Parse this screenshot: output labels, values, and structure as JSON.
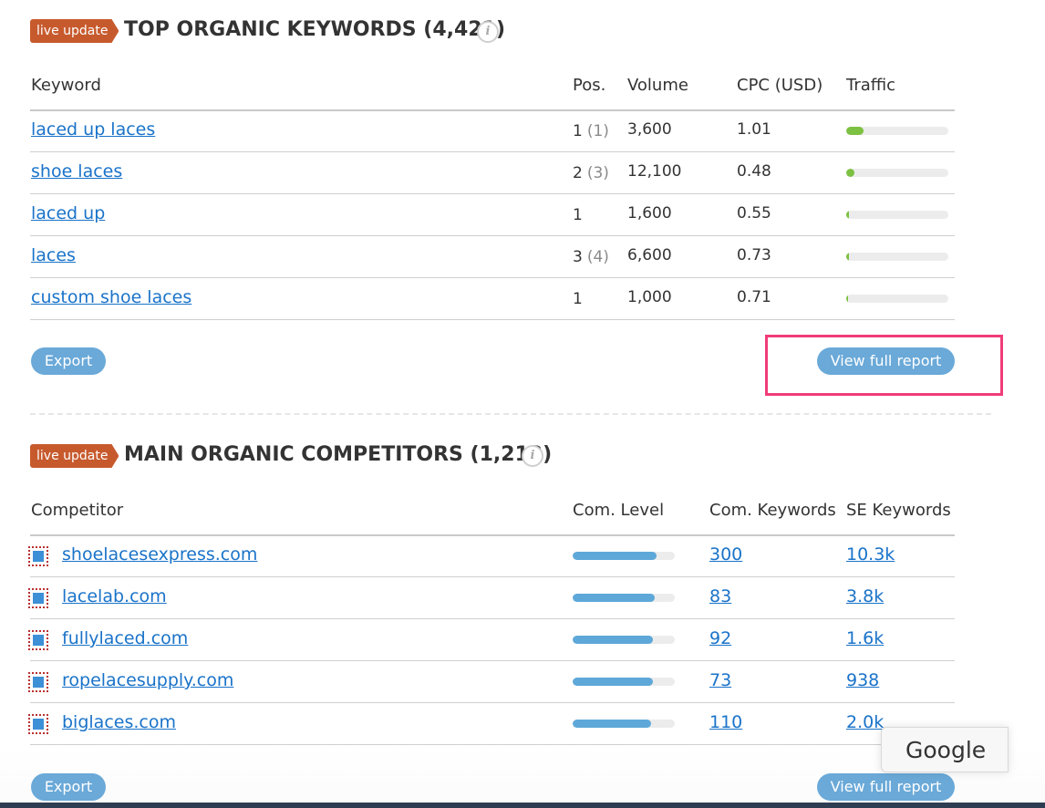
{
  "keywords_section": {
    "badge": "live update",
    "title": "TOP ORGANIC KEYWORDS (4,421)",
    "info": "i",
    "columns": [
      "Keyword",
      "Pos.",
      "Volume",
      "CPC (USD)",
      "Traffic"
    ],
    "rows": [
      {
        "keyword": "laced up laces",
        "pos": "1",
        "prev": "(1)",
        "volume": "3,600",
        "cpc": "1.01",
        "traffic": 0.17
      },
      {
        "keyword": "shoe laces",
        "pos": "2",
        "prev": "(3)",
        "volume": "12,100",
        "cpc": "0.48",
        "traffic": 0.08
      },
      {
        "keyword": "laced up",
        "pos": "1",
        "prev": "",
        "volume": "1,600",
        "cpc": "0.55",
        "traffic": 0.03
      },
      {
        "keyword": "laces",
        "pos": "3",
        "prev": "(4)",
        "volume": "6,600",
        "cpc": "0.73",
        "traffic": 0.025
      },
      {
        "keyword": "custom shoe laces",
        "pos": "1",
        "prev": "",
        "volume": "1,000",
        "cpc": "0.71",
        "traffic": 0.018
      }
    ],
    "export_label": "Export",
    "full_report_label": "View full report"
  },
  "competitors_section": {
    "badge": "live update",
    "title": "MAIN ORGANIC COMPETITORS (1,213)",
    "info": "i",
    "columns": [
      "Competitor",
      "Com. Level",
      "Com. Keywords",
      "SE Keywords"
    ],
    "rows": [
      {
        "domain": "shoelacesexpress.com",
        "level": 0.82,
        "com_keywords": "300",
        "se_keywords": "10.3k"
      },
      {
        "domain": "lacelab.com",
        "level": 0.8,
        "com_keywords": "83",
        "se_keywords": "3.8k"
      },
      {
        "domain": "fullylaced.com",
        "level": 0.79,
        "com_keywords": "92",
        "se_keywords": "1.6k"
      },
      {
        "domain": "ropelacesupply.com",
        "level": 0.79,
        "com_keywords": "73",
        "se_keywords": "938"
      },
      {
        "domain": "biglaces.com",
        "level": 0.77,
        "com_keywords": "110",
        "se_keywords": "2.0k"
      }
    ],
    "export_label": "Export",
    "full_report_label": "View full report"
  },
  "google_popup": {
    "label": "Google"
  },
  "colors": {
    "badge": "#c75a2d",
    "link": "#1a73c9",
    "traffic_bar": "#7dc142",
    "level_bar": "#5ea8d9",
    "button": "#6aa9d8",
    "highlight": "#f03c78"
  }
}
